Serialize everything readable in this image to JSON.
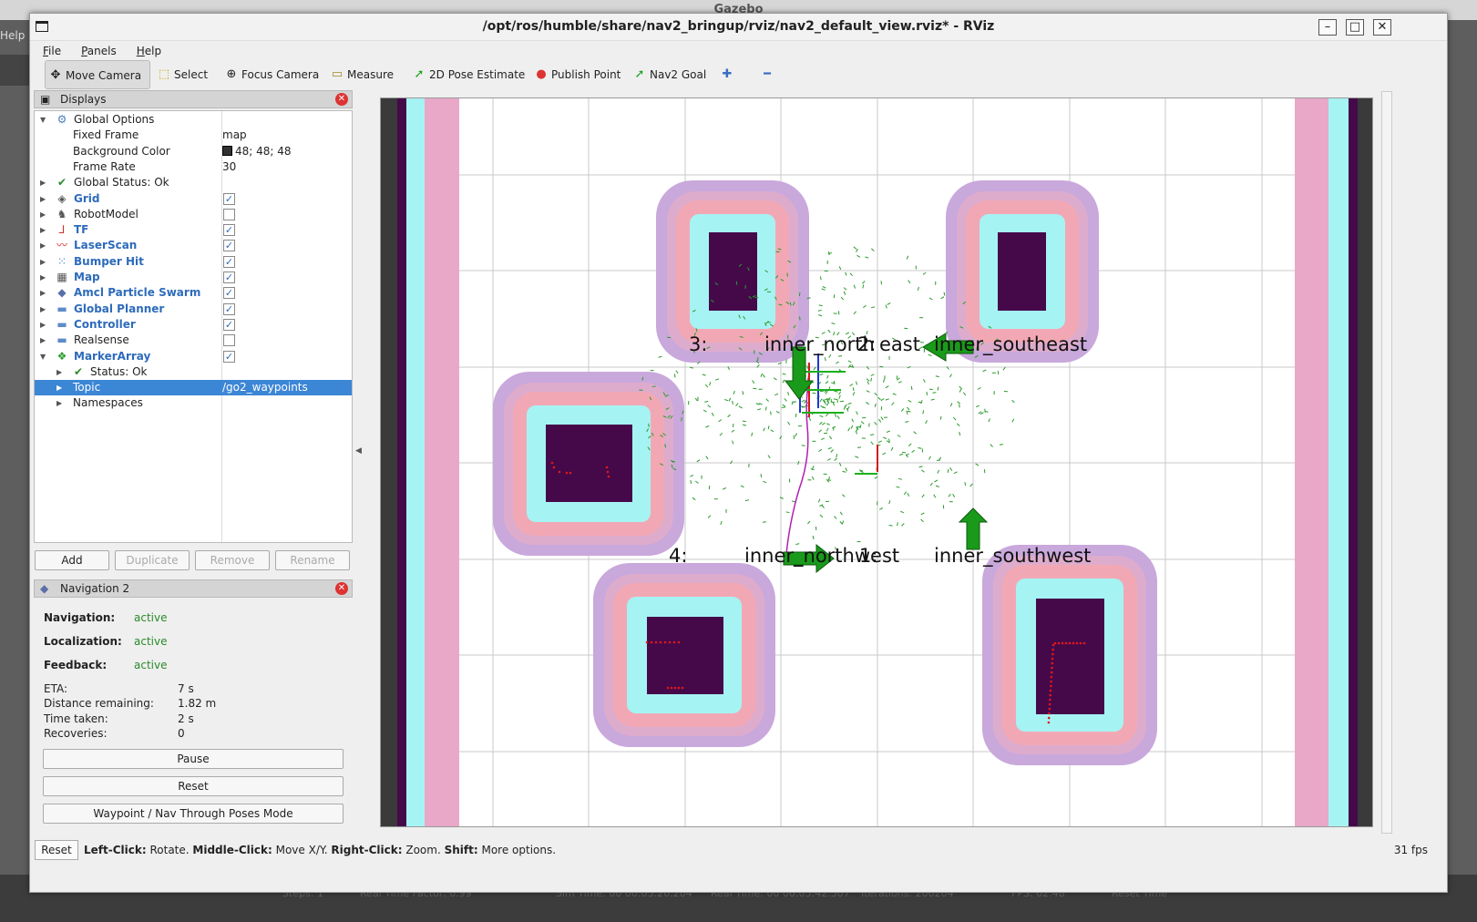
{
  "background": {
    "title": "Gazebo",
    "help": "Help",
    "status_items": [
      "Steps: 1",
      "Real Time Factor: 0.99",
      "Sim Time: 00 00:03:20.204",
      "Real Time: 00 00:03:42.307",
      "Iterations: 200204",
      "FPS: 62.48",
      "Reset Time"
    ]
  },
  "window": {
    "title": "/opt/ros/humble/share/nav2_bringup/rviz/nav2_default_view.rviz* - RViz",
    "controls": [
      "–",
      "□",
      "✕"
    ]
  },
  "menu": [
    "File",
    "Panels",
    "Help"
  ],
  "toolbar": [
    {
      "label": "Move Camera",
      "icon": "move-camera-icon",
      "glyph": "✥",
      "active": true
    },
    {
      "label": "Select",
      "icon": "select-icon",
      "glyph": "⬚",
      "active": false
    },
    {
      "label": "Focus Camera",
      "icon": "focus-camera-icon",
      "glyph": "⊕",
      "active": false
    },
    {
      "label": "Measure",
      "icon": "measure-icon",
      "glyph": "▭",
      "active": false
    },
    {
      "label": "2D Pose Estimate",
      "icon": "pose-estimate-icon",
      "glyph": "➚",
      "active": false
    },
    {
      "label": "Publish Point",
      "icon": "publish-point-icon",
      "glyph": "📍",
      "active": false
    },
    {
      "label": "Nav2 Goal",
      "icon": "nav2-goal-icon",
      "glyph": "➚",
      "active": false
    },
    {
      "label": "",
      "icon": "add-tool-icon",
      "glyph": "✚",
      "active": false
    },
    {
      "label": "",
      "icon": "remove-tool-icon",
      "glyph": "━",
      "active": false
    }
  ],
  "displays": {
    "title": "Displays",
    "rows": [
      {
        "label": "Global Options",
        "expanded": true,
        "level": 0,
        "icon": "gear-icon",
        "glyph": "⚙",
        "color": "#4a7fc0",
        "bold": false
      },
      {
        "label": "Fixed Frame",
        "value": "map",
        "level": 1,
        "icon": "",
        "glyph": "",
        "color": "",
        "bold": false
      },
      {
        "label": "Background Color",
        "value": "48; 48; 48",
        "swatch": true,
        "level": 1,
        "icon": "",
        "glyph": "",
        "color": "",
        "bold": false
      },
      {
        "label": "Frame Rate",
        "value": "30",
        "level": 1,
        "icon": "",
        "glyph": "",
        "color": "",
        "bold": false
      },
      {
        "label": "Global Status: Ok",
        "expanded": false,
        "level": 0,
        "icon": "check-icon",
        "glyph": "✔",
        "color": "#2a8a2a",
        "bold": false
      },
      {
        "label": "Grid",
        "expanded": false,
        "level": 0,
        "icon": "grid-icon",
        "glyph": "◈",
        "color": "#555",
        "bold": true,
        "checked": true
      },
      {
        "label": "RobotModel",
        "expanded": false,
        "level": 0,
        "icon": "robot-model-icon",
        "glyph": "♞",
        "color": "#555",
        "bold": false,
        "checked": false
      },
      {
        "label": "TF",
        "expanded": false,
        "level": 0,
        "icon": "tf-axes-icon",
        "glyph": "⅃",
        "color": "#c33",
        "bold": true,
        "checked": true
      },
      {
        "label": "LaserScan",
        "expanded": false,
        "level": 0,
        "icon": "laser-scan-icon",
        "glyph": "〰",
        "color": "#d22",
        "bold": true,
        "checked": true
      },
      {
        "label": "Bumper Hit",
        "expanded": false,
        "level": 0,
        "icon": "bumper-hit-icon",
        "glyph": "⁙",
        "color": "#4a7fc0",
        "bold": true,
        "checked": true
      },
      {
        "label": "Map",
        "expanded": false,
        "level": 0,
        "icon": "map-icon",
        "glyph": "▦",
        "color": "#555",
        "bold": true,
        "checked": true
      },
      {
        "label": "Amcl Particle Swarm",
        "expanded": false,
        "level": 0,
        "icon": "particle-swarm-icon",
        "glyph": "◆",
        "color": "#5a6fa8",
        "bold": true,
        "checked": true
      },
      {
        "label": "Global Planner",
        "expanded": false,
        "level": 0,
        "icon": "folder-icon",
        "glyph": "▬",
        "color": "#5d8cc8",
        "bold": true,
        "checked": true
      },
      {
        "label": "Controller",
        "expanded": false,
        "level": 0,
        "icon": "folder-icon",
        "glyph": "▬",
        "color": "#5d8cc8",
        "bold": true,
        "checked": true
      },
      {
        "label": "Realsense",
        "expanded": false,
        "level": 0,
        "icon": "folder-icon",
        "glyph": "▬",
        "color": "#5d8cc8",
        "bold": false,
        "checked": false
      },
      {
        "label": "MarkerArray",
        "expanded": true,
        "level": 0,
        "icon": "marker-array-icon",
        "glyph": "❖",
        "color": "#2a9a2a",
        "bold": true,
        "checked": true
      },
      {
        "label": "Status: Ok",
        "expanded": false,
        "level": 1,
        "icon": "check-icon",
        "glyph": "✔",
        "color": "#2a8a2a",
        "bold": false
      },
      {
        "label": "Topic",
        "value": "/go2_waypoints",
        "expanded": false,
        "level": 1,
        "icon": "",
        "glyph": "",
        "color": "",
        "bold": false,
        "selected": true
      },
      {
        "label": "Namespaces",
        "expanded": false,
        "level": 1,
        "icon": "",
        "glyph": "",
        "color": "",
        "bold": false
      }
    ],
    "buttons": [
      {
        "label": "Add",
        "enabled": true
      },
      {
        "label": "Duplicate",
        "enabled": false
      },
      {
        "label": "Remove",
        "enabled": false
      },
      {
        "label": "Rename",
        "enabled": false
      }
    ]
  },
  "nav2": {
    "title": "Navigation 2",
    "states": [
      {
        "label": "Navigation:",
        "value": "active"
      },
      {
        "label": "Localization:",
        "value": "active"
      },
      {
        "label": "Feedback:",
        "value": "active"
      }
    ],
    "metrics": [
      {
        "label": "ETA:",
        "value": "7 s"
      },
      {
        "label": "Distance remaining:",
        "value": "1.82 m"
      },
      {
        "label": "Time taken:",
        "value": "2 s"
      },
      {
        "label": "Recoveries:",
        "value": "0"
      }
    ],
    "buttons": [
      "Pause",
      "Reset",
      "Waypoint / Nav Through Poses Mode"
    ]
  },
  "viewport": {
    "labels": [
      {
        "text": "3:",
        "name": "waypoint-index-3"
      },
      {
        "text": "inner_north",
        "name": "waypoint-inner-north"
      },
      {
        "text": "2:",
        "name": "waypoint-index-2"
      },
      {
        "text": "east",
        "name": "waypoint-east-suffix"
      },
      {
        "text": "inner_southeast",
        "name": "waypoint-inner-southeast"
      },
      {
        "text": "4:",
        "name": "waypoint-index-4"
      },
      {
        "text": "inner_northwest",
        "name": "waypoint-inner-northwest"
      },
      {
        "text": "1:",
        "name": "waypoint-index-1"
      },
      {
        "text": "inner_southwest",
        "name": "waypoint-inner-southwest"
      }
    ],
    "colors": {
      "obstacle": "#45094a",
      "inflation_inner": "#a6f3f4",
      "inflation_mid": "#f2a8b4",
      "inflation_outer": "#c9a8dc",
      "arrow": "#1a9a1a",
      "particles": "#2a9a2a",
      "laser": "#e01818",
      "path": "#b020b0"
    }
  },
  "statusbar": {
    "reset": "Reset",
    "hint_parts": [
      {
        "text": "Left-Click:",
        "bold": true
      },
      {
        "text": " Rotate. ",
        "bold": false
      },
      {
        "text": "Middle-Click:",
        "bold": true
      },
      {
        "text": " Move X/Y. ",
        "bold": false
      },
      {
        "text": "Right-Click:",
        "bold": true
      },
      {
        "text": " Zoom. ",
        "bold": false
      },
      {
        "text": "Shift:",
        "bold": true
      },
      {
        "text": " More options.",
        "bold": false
      }
    ],
    "fps": "31 fps"
  }
}
